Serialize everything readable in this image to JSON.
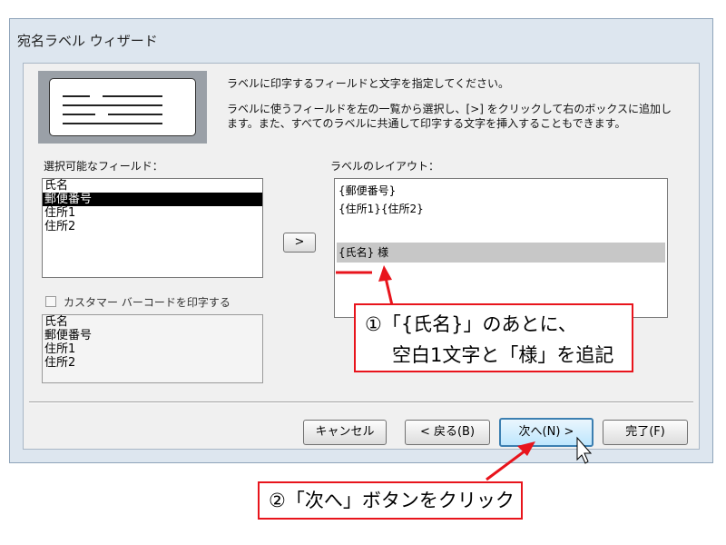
{
  "window": {
    "title": "宛名ラベル ウィザード"
  },
  "instructions": {
    "line1": "ラベルに印字するフィールドと文字を指定してください。",
    "line2": "ラベルに使うフィールドを左の一覧から選択し、[>] をクリックして右のボックスに追加し",
    "line3": "ます。また、すべてのラベルに共通して印字する文字を挿入することもできます。"
  },
  "available_fields": {
    "label": "選択可能なフィールド：",
    "items": [
      "氏名",
      "郵便番号",
      "住所1",
      "住所2"
    ],
    "selected_index": 1
  },
  "add_button_label": ">",
  "label_layout": {
    "label": "ラベルのレイアウト：",
    "lines": [
      "{郵便番号}",
      "{住所1}{住所2}",
      "",
      "{氏名} 様"
    ]
  },
  "barcode": {
    "checkbox_label": "カスタマー バーコードを印字する",
    "checked": false,
    "items": [
      "氏名",
      "郵便番号",
      "住所1",
      "住所2"
    ]
  },
  "buttons": {
    "cancel": "キャンセル",
    "back": "< 戻る(B)",
    "next": "次へ(N) >",
    "finish": "完了(F)"
  },
  "annotations": {
    "callout1_line1": "①「{氏名}」のあとに、",
    "callout1_line2": "空白1文字と「様」を追記",
    "callout2": "②「次へ」ボタンをクリック"
  },
  "colors": {
    "annotation_red": "#e8141c",
    "window_frame": "#dde6ef",
    "selection": "#000000",
    "layout_highlight": "#c7c7c7"
  }
}
